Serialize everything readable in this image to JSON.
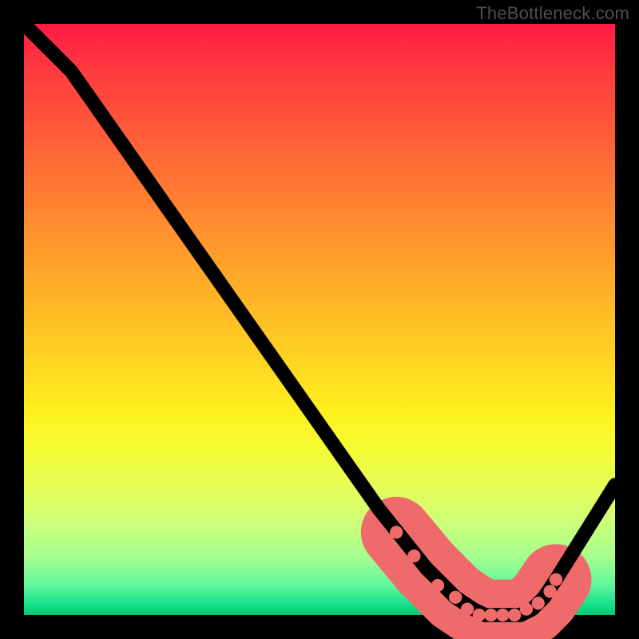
{
  "watermark": "TheBottleneck.com",
  "chart_data": {
    "type": "line",
    "title": "",
    "xlabel": "",
    "ylabel": "",
    "xlim": [
      0,
      100
    ],
    "ylim": [
      0,
      100
    ],
    "grid": false,
    "legend": false,
    "series": [
      {
        "name": "curve",
        "x": [
          0,
          8,
          60,
          68,
          73,
          76,
          78,
          80,
          82,
          84,
          86,
          88,
          90,
          100
        ],
        "y": [
          100,
          92,
          18,
          8,
          3,
          1,
          0,
          0,
          0,
          0,
          1,
          3,
          6,
          22
        ]
      }
    ],
    "highlight_segment": {
      "name": "valley-highlight",
      "x": [
        63,
        68,
        73,
        76,
        78,
        80,
        82,
        84,
        86,
        88,
        90
      ],
      "y": [
        14,
        8,
        3,
        1,
        0,
        0,
        0,
        0,
        1,
        3,
        6
      ]
    },
    "highlight_dots": {
      "x": [
        63,
        66,
        70,
        73,
        75,
        77,
        79,
        81,
        83,
        85,
        87,
        89,
        90
      ],
      "y": [
        14,
        10,
        5,
        3,
        1,
        0,
        0,
        0,
        0,
        1,
        2,
        4,
        6
      ]
    },
    "colors": {
      "curve": "#000000",
      "highlight": "#ef6b6b",
      "gradient_top": "#ff1a46",
      "gradient_bottom": "#08c772"
    }
  }
}
